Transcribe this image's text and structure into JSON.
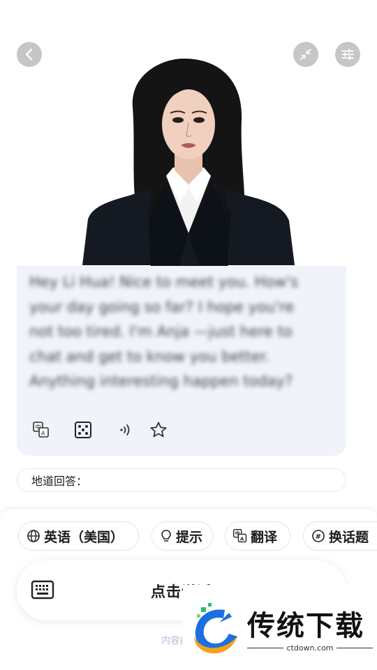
{
  "header": {
    "back_icon": "chevron-left-icon",
    "shrink_icon": "collapse-arrows-icon",
    "settings_icon": "sliders-icon"
  },
  "chat": {
    "message": "Hey Li Hua! Nice to meet you. How's your day going so far? I hope you're not too tired. I'm Anja —just here to chat and get to know you better. Anything interesting happen today?",
    "tools": [
      "translate-icon",
      "dice-icon",
      "audio-wave-icon",
      "star-icon"
    ]
  },
  "idiom": {
    "label": "地道回答："
  },
  "chips": {
    "language": "英语（美国）",
    "hint": "提示",
    "translate": "翻译",
    "topic": "换话题"
  },
  "talk": {
    "label": "点击说话"
  },
  "ai_note": "内容由AI生成",
  "watermark": {
    "title": "传统下载",
    "domain": "ctdown.com"
  },
  "colors": {
    "round_button": "#c6c6c8",
    "bubble_bg": "#f0f3f9",
    "ai_note": "#b3b9d4",
    "watermark_blue": "#1d6fe0",
    "watermark_orange": "#f5a11a",
    "watermark_green": "#2ebd6b"
  }
}
